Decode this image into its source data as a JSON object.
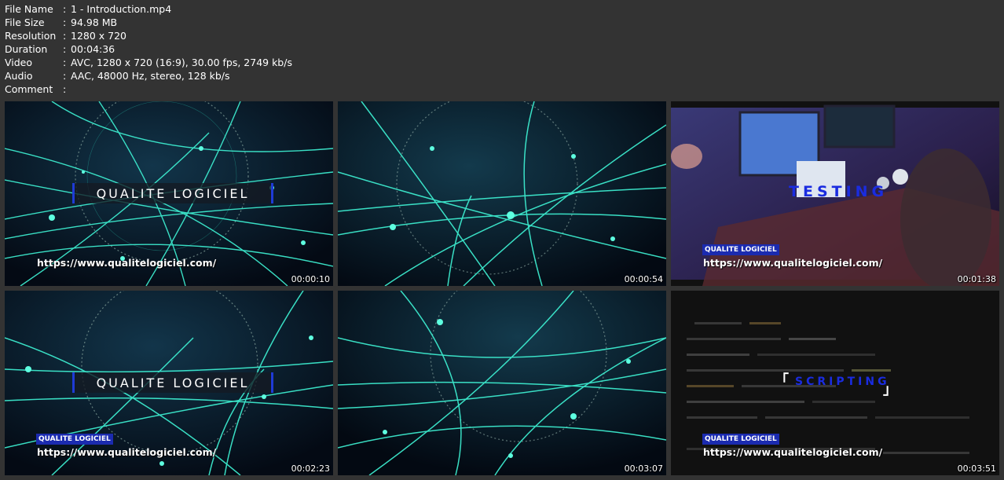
{
  "meta": {
    "rows": [
      {
        "key": "File Name",
        "sep": ":",
        "value": "1 - Introduction.mp4"
      },
      {
        "key": "File Size",
        "sep": ":",
        "value": "94.98 MB"
      },
      {
        "key": "Resolution",
        "sep": ":",
        "value": "1280 x 720"
      },
      {
        "key": "Duration",
        "sep": ":",
        "value": "00:04:36"
      },
      {
        "key": "Video",
        "sep": ":",
        "value": "AVC, 1280 x 720 (16:9), 30.00 fps, 2749 kb/s"
      },
      {
        "key": "Audio",
        "sep": ":",
        "value": "AAC, 48000 Hz, stereo, 128 kb/s"
      },
      {
        "key": "Comment",
        "sep": ":",
        "value": ""
      }
    ]
  },
  "thumbs": [
    {
      "time": "00:00:10",
      "title": "QUALITE LOGICIEL",
      "url": "https://www.qualitelogiciel.com/"
    },
    {
      "time": "00:00:54"
    },
    {
      "time": "00:01:38",
      "word": "TESTING",
      "badge": "QUALITE LOGICIEL",
      "url": "https://www.qualitelogiciel.com/"
    },
    {
      "time": "00:02:23",
      "title": "QUALITE LOGICIEL",
      "badge": "QUALITE LOGICIEL",
      "url": "https://www.qualitelogiciel.com/"
    },
    {
      "time": "00:03:07"
    },
    {
      "time": "00:03:51",
      "word": "SCRIPTING",
      "bracket_open": "「",
      "bracket_close": "」",
      "badge": "QUALITE LOGICIEL",
      "url": "https://www.qualitelogiciel.com/"
    }
  ],
  "colors": {
    "background": "#333333",
    "accent_blue": "#1b2bb0",
    "cyan_lines": "#3ff5d6"
  }
}
